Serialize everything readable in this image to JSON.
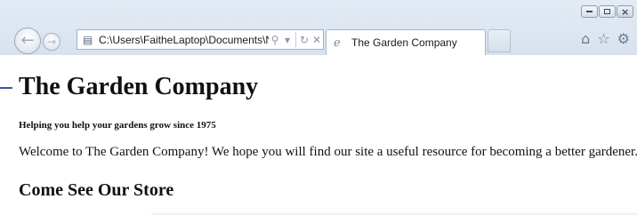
{
  "browser": {
    "address_bar": {
      "url": "C:\\Users\\FaitheLaptop\\Documents\\N",
      "search_icon": "search-icon",
      "dropdown_icon": "chevron-down-icon",
      "refresh_icon": "refresh-icon",
      "stop_icon": "close-icon"
    },
    "tab": {
      "title": "The Garden Company",
      "favicon": "ie-page-icon"
    },
    "window_buttons": [
      "minimize",
      "maximize",
      "close"
    ],
    "toolbar_icons": [
      "home-icon",
      "favorites-star-icon",
      "settings-gear-icon"
    ]
  },
  "page": {
    "heading": "The Garden Company",
    "tagline": "Helping you help your gardens grow since 1975",
    "welcome": "Welcome to The Garden Company! We hope you will find our site a useful resource for becoming a better gardener.",
    "section_heading": "Come See Our Store"
  }
}
